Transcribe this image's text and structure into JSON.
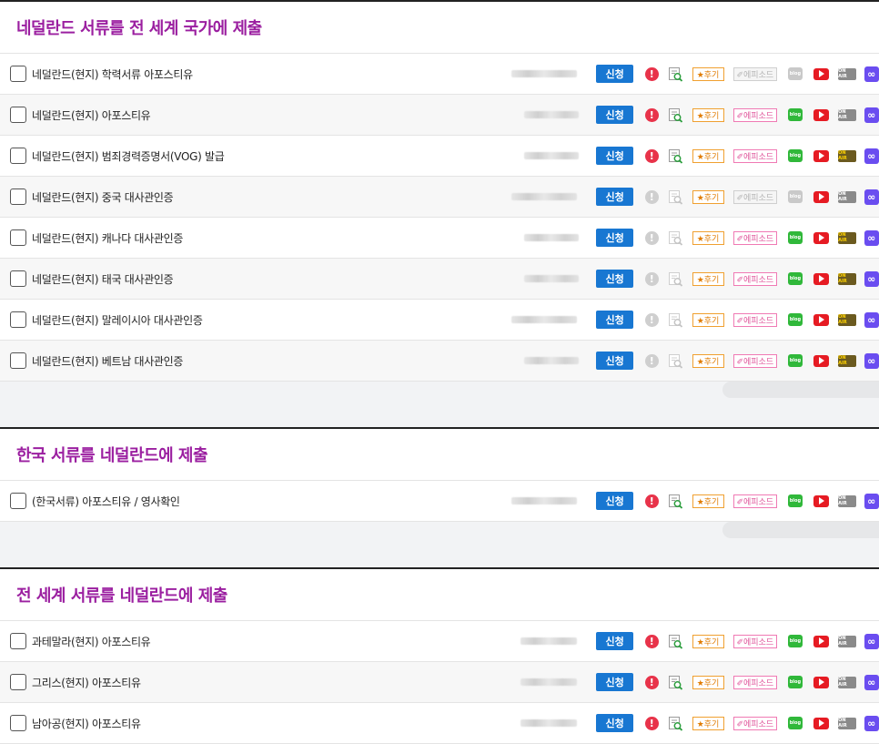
{
  "common": {
    "apply_label": "신청",
    "alert_symbol": "!",
    "review_label": "★후기",
    "episode_label": "✐에피소드",
    "blog_label": "blog",
    "tv_label": "ON AIR",
    "link_symbol": "∞"
  },
  "colors": {
    "title": "#9b1fa0",
    "apply": "#1877d2",
    "alert": "#e8334a",
    "youtube": "#e61b23",
    "link": "#6a4df0",
    "blog": "#30b83a"
  },
  "sections": [
    {
      "title": "네덜란드 서류를 전 세계 국가에 제출",
      "rows": [
        {
          "label": "네덜란드(현지) 학력서류 아포스티유",
          "alert": true,
          "episode": false,
          "blog": false,
          "tv": false
        },
        {
          "label": "네덜란드(현지) 아포스티유",
          "alert": true,
          "episode": true,
          "blog": true,
          "tv": false
        },
        {
          "label": "네덜란드(현지) 범죄경력증명서(VOG) 발급",
          "alert": true,
          "episode": true,
          "blog": true,
          "tv": true
        },
        {
          "label": "네덜란드(현지) 중국 대사관인증",
          "alert": false,
          "episode": false,
          "blog": false,
          "tv": false
        },
        {
          "label": "네덜란드(현지) 캐나다 대사관인증",
          "alert": false,
          "episode": true,
          "blog": true,
          "tv": true
        },
        {
          "label": "네덜란드(현지) 태국 대사관인증",
          "alert": false,
          "episode": true,
          "blog": true,
          "tv": true
        },
        {
          "label": "네덜란드(현지) 말레이시아 대사관인증",
          "alert": false,
          "episode": true,
          "blog": true,
          "tv": true
        },
        {
          "label": "네덜란드(현지) 베트남 대사관인증",
          "alert": false,
          "episode": true,
          "blog": true,
          "tv": true
        }
      ]
    },
    {
      "title": "한국 서류를 네덜란드에 제출",
      "rows": [
        {
          "label": "(한국서류) 아포스티유 / 영사확인",
          "alert": true,
          "episode": true,
          "blog": true,
          "tv": false
        }
      ]
    },
    {
      "title": "전 세계 서류를 네덜란드에 제출",
      "rows": [
        {
          "label": "과테말라(현지) 아포스티유",
          "alert": true,
          "episode": true,
          "blog": true,
          "tv": false
        },
        {
          "label": "그리스(현지) 아포스티유",
          "alert": true,
          "episode": true,
          "blog": true,
          "tv": false
        },
        {
          "label": "남아공(현지) 아포스티유",
          "alert": true,
          "episode": true,
          "blog": true,
          "tv": false
        }
      ]
    }
  ]
}
